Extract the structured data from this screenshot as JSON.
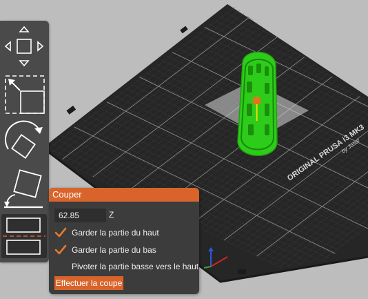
{
  "bed": {
    "brand_line": "ORIGINAL PRUSA i3 MK3",
    "sub_line": "by Josef"
  },
  "toolbar": {
    "tools": [
      {
        "name": "move",
        "icon": "move-arrows-icon"
      },
      {
        "name": "scale",
        "icon": "scale-icon"
      },
      {
        "name": "rotate",
        "icon": "rotate-icon"
      },
      {
        "name": "place-on-face",
        "icon": "place-on-face-icon"
      },
      {
        "name": "cut",
        "icon": "cut-icon",
        "active": true
      }
    ]
  },
  "cut_panel": {
    "title": "Couper",
    "z_value": "62.85",
    "z_label": "Z",
    "keep_upper": {
      "label": "Garder la partie du haut",
      "checked": true
    },
    "keep_lower": {
      "label": "Garder la partie du bas",
      "checked": true
    },
    "rotate_lower": {
      "label": "Pivoter la partie basse vers le haut",
      "checked": false
    },
    "button_label": "Effectuer la coupe"
  },
  "colors": {
    "accent": "#d9642b",
    "model": "#2ecc1a",
    "bed": "#2c2c2c",
    "background": "#bdbdbd"
  }
}
